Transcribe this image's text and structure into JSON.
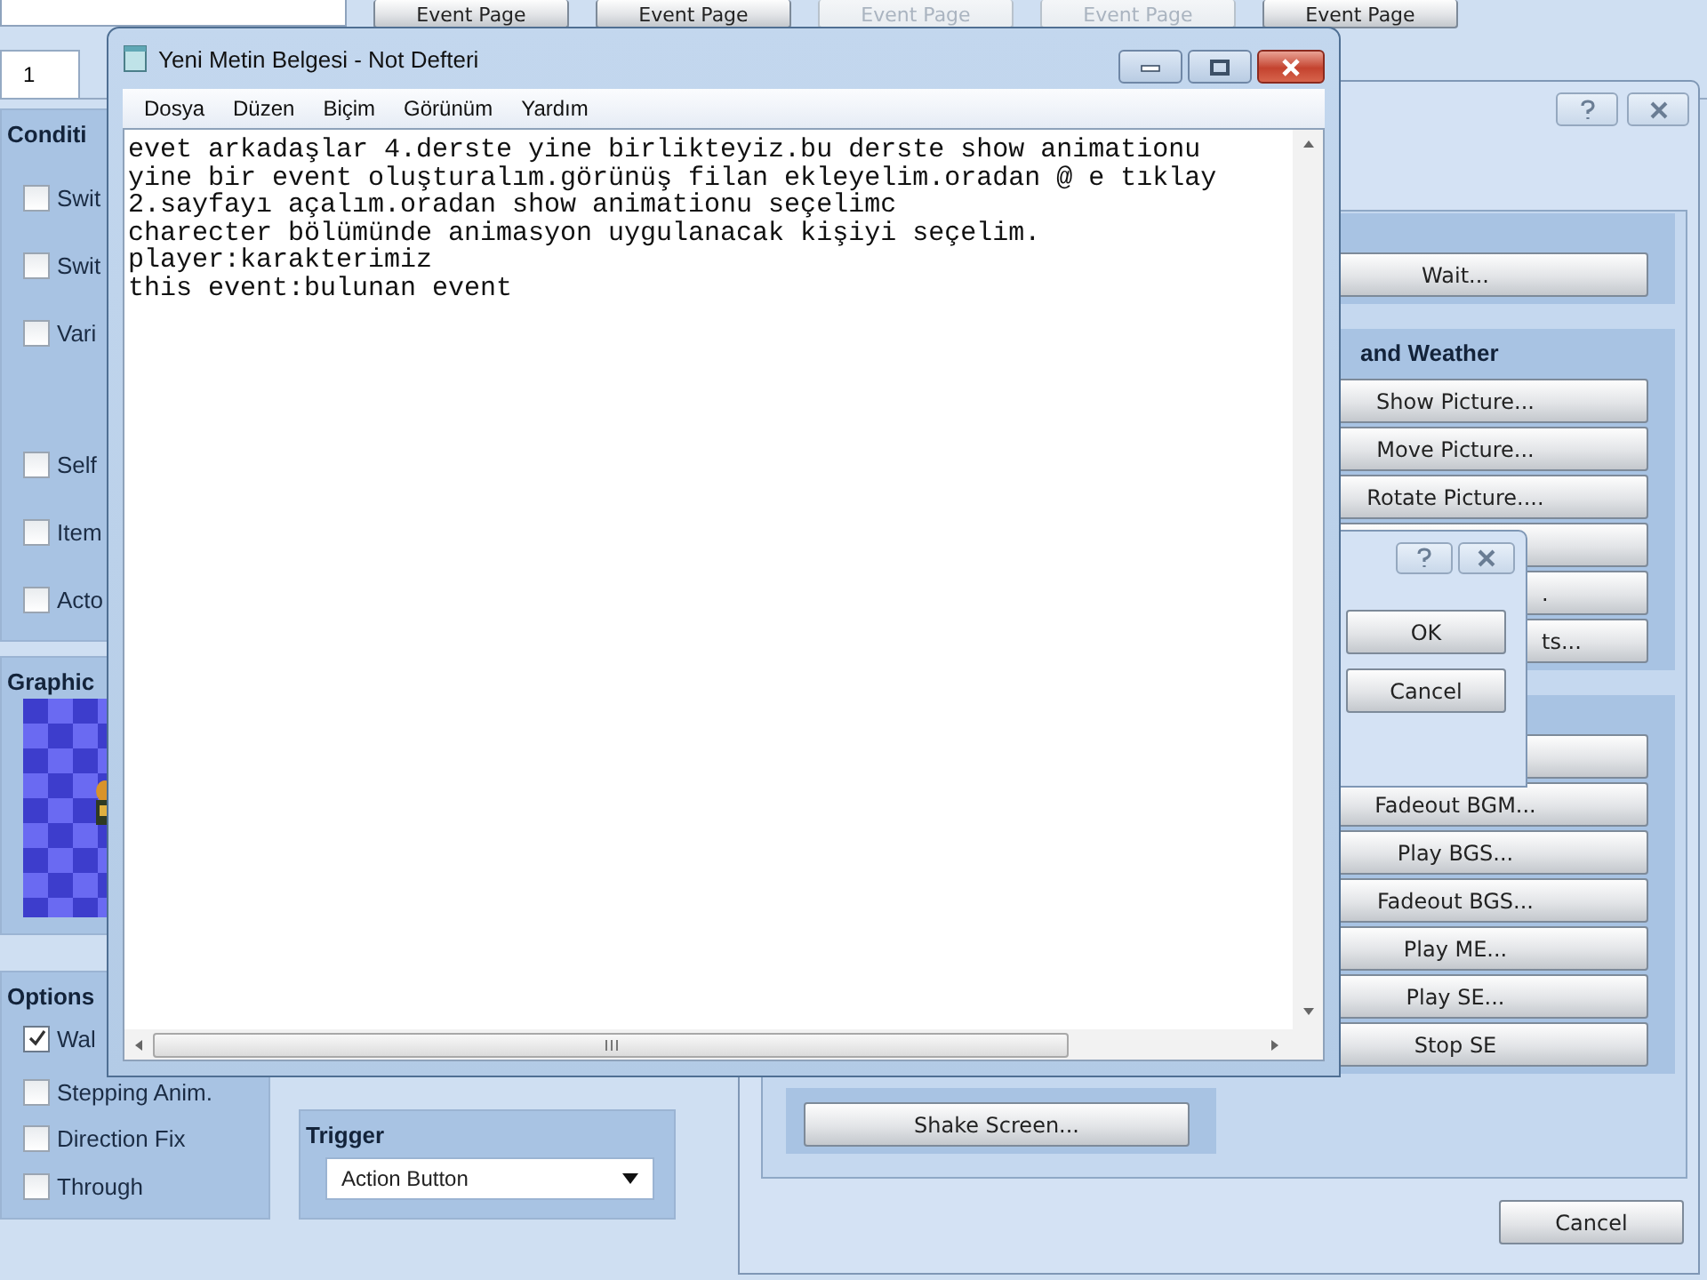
{
  "event_editor": {
    "page_buttons": [
      {
        "label": "Event Page",
        "disabled": false
      },
      {
        "label": "Event Page",
        "disabled": false
      },
      {
        "label": "Event Page",
        "disabled": true
      },
      {
        "label": "Event Page",
        "disabled": true
      },
      {
        "label": "Event Page",
        "disabled": false
      }
    ],
    "tabs": [
      {
        "label": "1",
        "selected": true
      }
    ],
    "conditions": {
      "title": "Conditi",
      "items": [
        {
          "label": "Swit",
          "checked": false
        },
        {
          "label": "Swit",
          "checked": false
        },
        {
          "label": "Vari",
          "checked": false
        },
        {
          "label": "Self",
          "checked": false
        },
        {
          "label": "Item",
          "checked": false
        },
        {
          "label": "Acto",
          "checked": false
        }
      ]
    },
    "graphic": {
      "title": "Graphic"
    },
    "options": {
      "title": "Options",
      "items": [
        {
          "label": "Wal",
          "checked": true
        },
        {
          "label": "Stepping Anim.",
          "checked": false
        },
        {
          "label": "Direction Fix",
          "checked": false
        },
        {
          "label": "Through",
          "checked": false
        }
      ]
    },
    "trigger": {
      "title": "Trigger",
      "value": "Action Button"
    }
  },
  "commands_window": {
    "left_groups": [
      {
        "buttons": [
          {
            "label": "Shake Screen...",
            "kind": "normal"
          }
        ]
      }
    ],
    "right_groups": [
      {
        "buttons": [
          {
            "label": "Wait...",
            "kind": "normal"
          }
        ]
      },
      {
        "title": "and Weather",
        "buttons": [
          {
            "label": "Show Picture...",
            "kind": "normal"
          },
          {
            "label": "Move Picture...",
            "kind": "normal"
          },
          {
            "label": "Rotate Picture....",
            "kind": "normal"
          },
          {
            "kind": "covered"
          },
          {
            "label": ".",
            "kind": "covered"
          },
          {
            "label": "ts...",
            "kind": "covered"
          }
        ]
      },
      {
        "buttons": [
          {
            "kind": "covered"
          },
          {
            "label": "Fadeout BGM...",
            "kind": "normal"
          },
          {
            "label": "Play BGS...",
            "kind": "normal"
          },
          {
            "label": "Fadeout BGS...",
            "kind": "normal"
          },
          {
            "label": "Play ME...",
            "kind": "normal"
          },
          {
            "label": "Play SE...",
            "kind": "normal"
          },
          {
            "label": "Stop SE",
            "kind": "normal"
          }
        ]
      }
    ],
    "cancel": "Cancel"
  },
  "dialog": {
    "ok": "OK",
    "cancel": "Cancel"
  },
  "notepad": {
    "title": "Yeni Metin Belgesi - Not Defteri",
    "menu": [
      "Dosya",
      "Düzen",
      "Biçim",
      "Görünüm",
      "Yardım"
    ],
    "lines": [
      "evet arkadaşlar 4.derste yine birlikteyiz.bu derste show animationu",
      "yine bir event oluşturalım.görünüş filan ekleyelim.oradan @ e tıklay",
      "2.sayfayı açalım.oradan show animationu seçelimc",
      "charecter bölümünde animasyon uygulanacak kişiyi seçelim.",
      "player:karakterimiz",
      "this event:bulunan event"
    ]
  }
}
